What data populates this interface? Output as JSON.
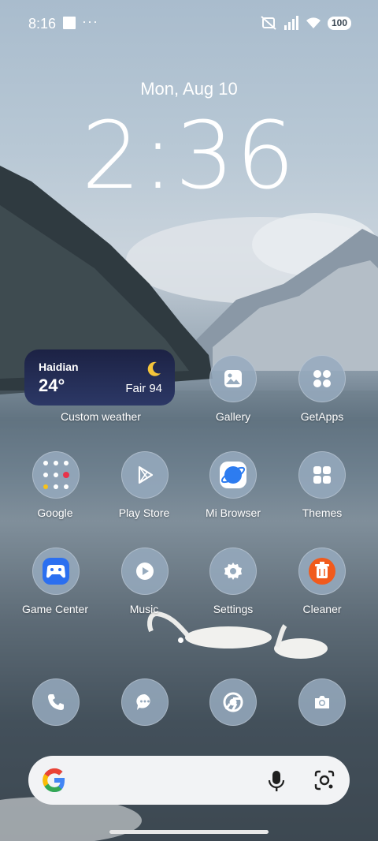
{
  "status_bar": {
    "time": "8:16",
    "more": "···",
    "battery": "100"
  },
  "lock": {
    "date": "Mon, Aug 10",
    "clock": "2:36"
  },
  "weather_widget": {
    "location": "Haidian",
    "temperature": "24°",
    "condition": "Fair 94",
    "label": "Custom weather"
  },
  "apps_row1": [
    {
      "label": "Gallery"
    },
    {
      "label": "GetApps"
    }
  ],
  "apps_row2": [
    {
      "label": "Google"
    },
    {
      "label": "Play Store"
    },
    {
      "label": "Mi Browser"
    },
    {
      "label": "Themes"
    }
  ],
  "apps_row3": [
    {
      "label": "Game Center"
    },
    {
      "label": "Music"
    },
    {
      "label": "Settings"
    },
    {
      "label": "Cleaner"
    }
  ],
  "dock": [
    {
      "icon": "phone-icon"
    },
    {
      "icon": "messages-icon"
    },
    {
      "icon": "chrome-icon"
    },
    {
      "icon": "camera-icon"
    }
  ],
  "search_bar": {
    "icons": [
      "google-g-icon",
      "mic-icon",
      "lens-icon"
    ]
  },
  "colors": {
    "accent_weather": "#1c2244",
    "cleaner": "#f15a1c",
    "game_center": "#2b6ff0",
    "browser": "#2d7cf0"
  }
}
